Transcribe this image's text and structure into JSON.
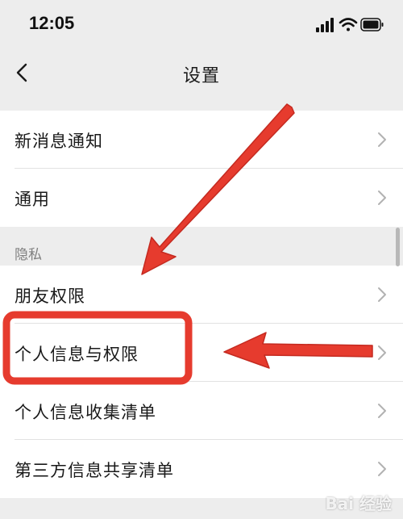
{
  "status_bar": {
    "time": "12:05"
  },
  "nav": {
    "title": "设置"
  },
  "settings_top": [
    {
      "label": "新消息通知"
    },
    {
      "label": "通用"
    }
  ],
  "privacy": {
    "header": "隐私",
    "items": [
      {
        "label": "朋友权限"
      },
      {
        "label": "个人信息与权限"
      },
      {
        "label": "个人信息收集清单"
      },
      {
        "label": "第三方信息共享清单"
      }
    ]
  },
  "annotation": {
    "highlighted_item": "个人信息与权限",
    "color": "#e63b2e"
  },
  "watermark": {
    "text": "Bai 经验"
  },
  "colors": {
    "background": "#ededed",
    "row_background": "#ffffff",
    "section_text": "#7f7f7f",
    "annotation_red": "#e63b2e"
  }
}
